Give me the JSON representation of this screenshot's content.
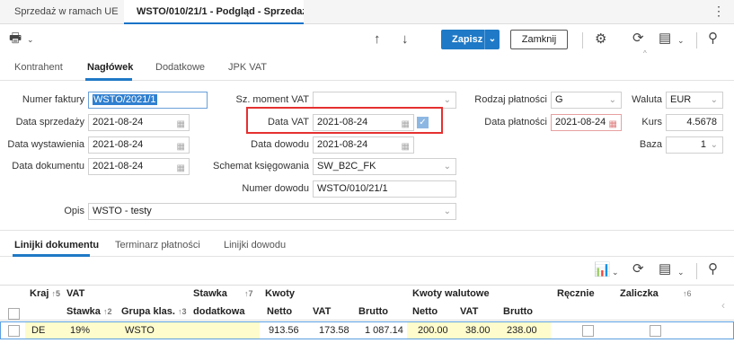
{
  "tabs": [
    {
      "label": "Sprzedaż w ramach UE"
    },
    {
      "label": "WSTO/010/21/1 - Podgląd - Sprzedaż"
    }
  ],
  "toolbar": {
    "save": "Zapisz",
    "close": "Zamknij"
  },
  "section_tabs": [
    "Kontrahent",
    "Nagłówek",
    "Dodatkowe",
    "JPK VAT"
  ],
  "form": {
    "numer_faktury": {
      "label": "Numer faktury",
      "value": "WSTO/2021/1"
    },
    "data_sprzedazy": {
      "label": "Data sprzedaży",
      "value": "2021-08-24"
    },
    "data_wystawienia": {
      "label": "Data wystawienia",
      "value": "2021-08-24"
    },
    "data_dokumentu": {
      "label": "Data dokumentu",
      "value": "2021-08-24"
    },
    "sz_moment_vat": {
      "label": "Sz. moment VAT",
      "value": ""
    },
    "data_vat": {
      "label": "Data VAT",
      "value": "2021-08-24"
    },
    "data_dowodu": {
      "label": "Data dowodu",
      "value": "2021-08-24"
    },
    "schemat": {
      "label": "Schemat księgowania",
      "value": "SW_B2C_FK"
    },
    "numer_dowodu": {
      "label": "Numer dowodu",
      "value": "WSTO/010/21/1"
    },
    "opis": {
      "label": "Opis",
      "value": "WSTO - testy"
    },
    "rodzaj_platnosci": {
      "label": "Rodzaj płatności",
      "value": "G"
    },
    "data_platnosci": {
      "label": "Data płatności",
      "value": "2021-08-24"
    },
    "waluta": {
      "label": "Waluta",
      "value": "EUR"
    },
    "kurs": {
      "label": "Kurs",
      "value": "4.5678"
    },
    "baza": {
      "label": "Baza",
      "value": "1"
    }
  },
  "bottom_tabs": [
    "Linijki dokumentu",
    "Terminarz płatności",
    "Linijki dowodu"
  ],
  "grid": {
    "group_headers": {
      "kraj": "Kraj",
      "vat": "VAT",
      "stawka_dod": "Stawka",
      "kwoty": "Kwoty",
      "kwoty_wal": "Kwoty walutowe",
      "recznie": "Ręcznie",
      "zaliczka": "Zaliczka"
    },
    "sub_headers": {
      "stawka": "Stawka",
      "grupa": "Grupa klas.",
      "dodatkowa": "dodatkowa",
      "netto": "Netto",
      "vat": "VAT",
      "brutto": "Brutto",
      "netto_w": "Netto",
      "vat_w": "VAT",
      "brutto_w": "Brutto"
    },
    "sort_marks": {
      "kraj": "5",
      "stawka": "2",
      "grupa": "3",
      "stawka_dod": "7",
      "zaliczka": "6"
    },
    "row": {
      "kraj": "DE",
      "stawka": "19%",
      "grupa": "WSTO",
      "dodatkowa": "",
      "netto": "913.56",
      "vat": "173.58",
      "brutto": "1 087.14",
      "netto_w": "200.00",
      "vat_w": "38.00",
      "brutto_w": "238.00"
    }
  }
}
